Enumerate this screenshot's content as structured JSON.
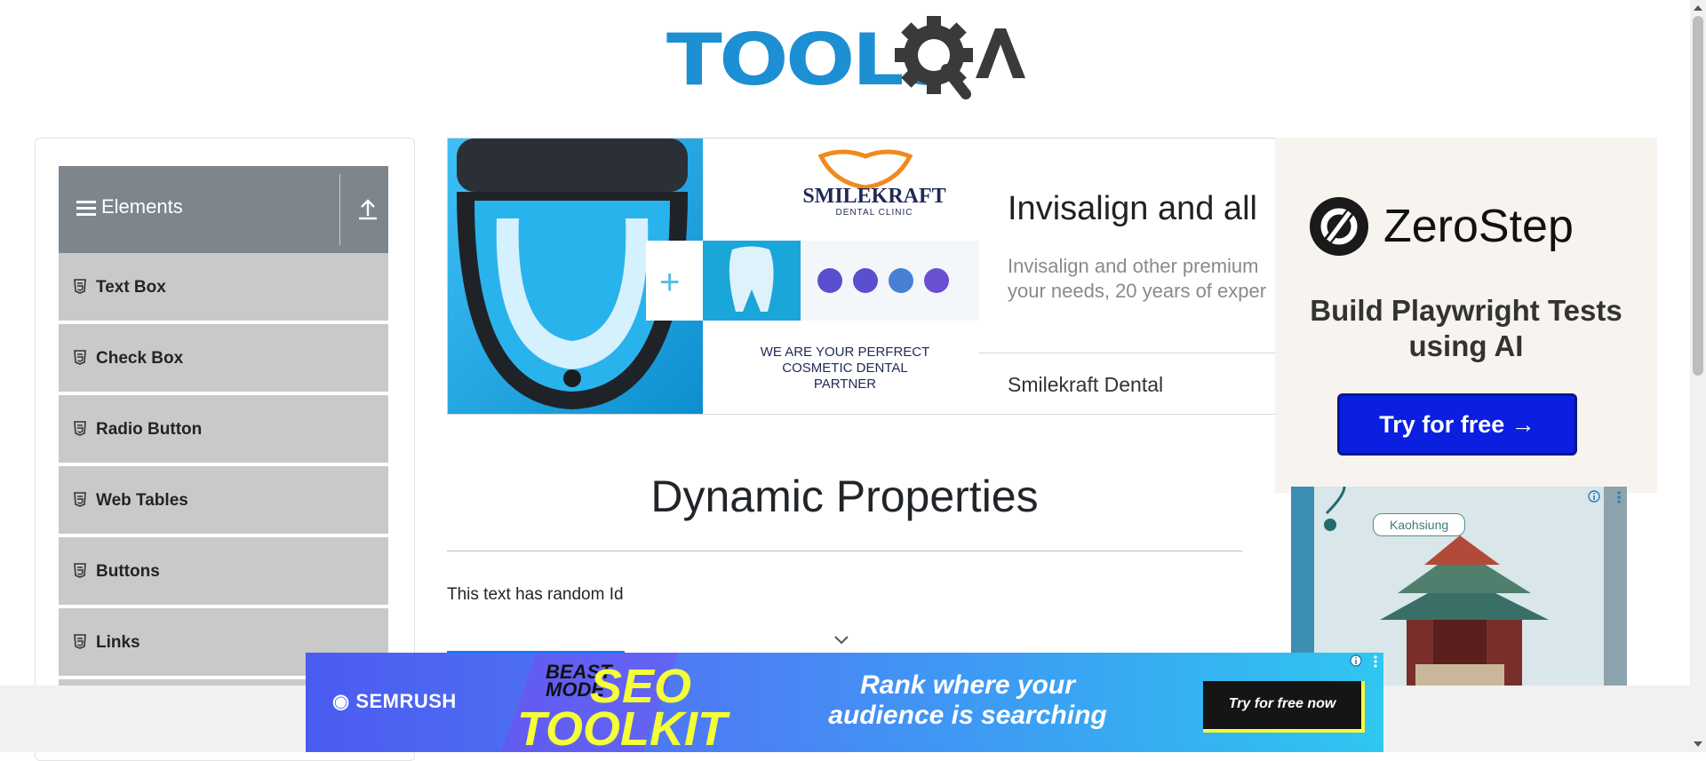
{
  "brand": {
    "logo_part1": "TOOLS",
    "logo_part2": "QA"
  },
  "sidebar": {
    "group_label": "Elements",
    "items": [
      {
        "label": "Text Box"
      },
      {
        "label": "Check Box"
      },
      {
        "label": "Radio Button"
      },
      {
        "label": "Web Tables"
      },
      {
        "label": "Buttons"
      },
      {
        "label": "Links"
      }
    ]
  },
  "top_ad": {
    "clinic_name": "SMILEKRAFT",
    "clinic_sub": "DENTAL CLINIC",
    "slogan_lines": [
      "WE ARE YOUR PERFRECT",
      "COSMETIC DENTAL",
      "PARTNER"
    ],
    "headline": "Invisalign and all",
    "description_lines": [
      "Invisalign and other premium",
      "your needs, 20 years of exper"
    ],
    "advertiser": "Smilekraft Dental"
  },
  "main": {
    "title": "Dynamic Properties",
    "random_id_text": "This text has random Id"
  },
  "right_ad": {
    "brand": "ZeroStep",
    "tagline": "Build Playwright Tests using AI",
    "cta": "Try for free →"
  },
  "photo_ad": {
    "pin_label": "Kaohsiung"
  },
  "bottom_ad": {
    "brand": "SEMRUSH",
    "beast_line1": "BEAST",
    "beast_line2": "MODE",
    "seo": "SEO",
    "toolkit": "TOOLKIT",
    "tagline": "Rank where your audience is searching",
    "cta": "Try for free now"
  },
  "colors": {
    "logo_blue": "#1d8fd3",
    "logo_dark": "#3a3a3a",
    "sidebar_header": "#7e868d",
    "menu_item_bg": "#c9c9c9",
    "zerostep_cta": "#0a1fe0"
  }
}
